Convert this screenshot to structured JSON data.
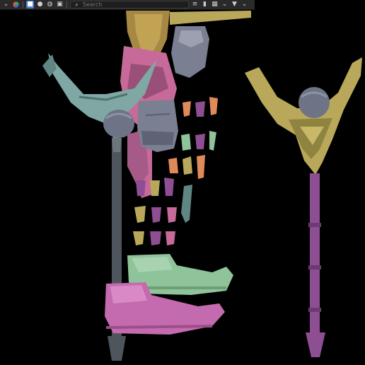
{
  "toolbar": {
    "search": {
      "placeholder": "Search",
      "value": ""
    },
    "icons": [
      "chevron-down-icon",
      "color-wheel-icon",
      "object-mode-icon",
      "sphere-icon",
      "globe-icon",
      "image-icon",
      "magnifier-icon",
      "list-icon",
      "bookmark-icon",
      "layout-icon",
      "chevron-down-icon",
      "filter-icon",
      "chevron-down-icon"
    ]
  },
  "viewport": {
    "background": "#000000",
    "colors": {
      "staff_teal": "#7fa7a4",
      "staff_gold": "#b9a85a",
      "shaft_purple": "#8e4e92",
      "robe_pink": "#c76a9a",
      "gauntlet_gray": "#7b7f92",
      "boot_green": "#8fc39a",
      "boot_pink": "#c46bb0",
      "helm_gold": "#a68844",
      "orb_gray": "#6e7486"
    }
  }
}
